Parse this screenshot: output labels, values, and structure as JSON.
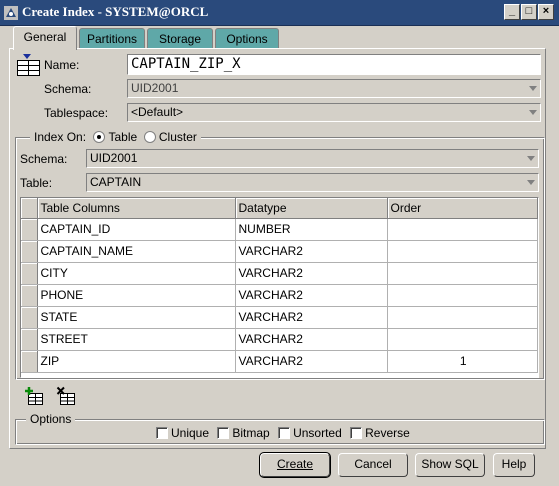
{
  "window": {
    "title": "Create Index - SYSTEM@ORCL"
  },
  "tabs": [
    {
      "label": "General",
      "active": true
    },
    {
      "label": "Partitions",
      "active": false
    },
    {
      "label": "Storage",
      "active": false
    },
    {
      "label": "Options",
      "active": false
    }
  ],
  "general": {
    "name_label": "Name:",
    "name_value": "CAPTAIN_ZIP_X",
    "schema_label": "Schema:",
    "schema_value": "UID2001",
    "tablespace_label": "Tablespace:",
    "tablespace_value": "<Default>"
  },
  "index_on": {
    "label": "Index On:",
    "options": [
      "Table",
      "Cluster"
    ],
    "selected": "Table",
    "schema_label": "Schema:",
    "schema_value": "UID2001",
    "table_label": "Table:",
    "table_value": "CAPTAIN"
  },
  "columns_table": {
    "headers": [
      "Table Columns",
      "Datatype",
      "Order"
    ],
    "rows": [
      [
        "CAPTAIN_ID",
        "NUMBER",
        ""
      ],
      [
        "CAPTAIN_NAME",
        "VARCHAR2",
        ""
      ],
      [
        "CITY",
        "VARCHAR2",
        ""
      ],
      [
        "PHONE",
        "VARCHAR2",
        ""
      ],
      [
        "STATE",
        "VARCHAR2",
        ""
      ],
      [
        "STREET",
        "VARCHAR2",
        ""
      ],
      [
        "ZIP",
        "VARCHAR2",
        "1"
      ]
    ]
  },
  "options": {
    "label": "Options",
    "checkboxes": [
      "Unique",
      "Bitmap",
      "Unsorted",
      "Reverse"
    ]
  },
  "buttons": {
    "create": "Create",
    "cancel": "Cancel",
    "show_sql": "Show SQL",
    "help": "Help"
  },
  "colors": {
    "titlebar": "#2a4a7c",
    "inactive_tab": "#5fa8a8",
    "face": "#d4d0c8"
  }
}
